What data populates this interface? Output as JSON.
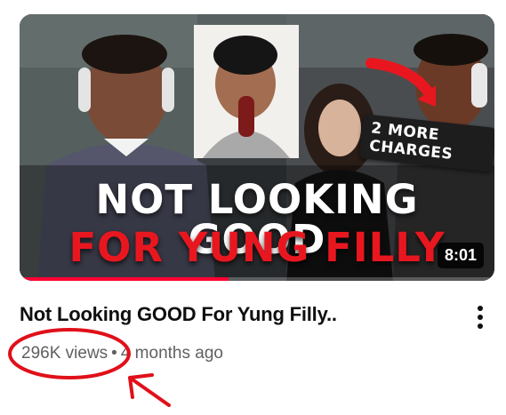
{
  "video": {
    "thumbnail": {
      "headline_line1": "NOT LOOKING GOOD",
      "headline_line2": "FOR YUNG FILLY",
      "callout": "2 MORE CHARGES",
      "duration": "8:01",
      "watch_progress": 0.44,
      "progress_color": "#ff0033",
      "headline_accent_color": "#e8171f"
    },
    "title": "Not Looking GOOD For Yung Filly..",
    "views": "296K views",
    "separator": "•",
    "age": "4 months ago",
    "menu_icon": "more-vert-icon"
  },
  "annotation": {
    "color": "#e0101a",
    "shapes": [
      "circle-around-views",
      "arrow-pointing-to-views"
    ]
  }
}
